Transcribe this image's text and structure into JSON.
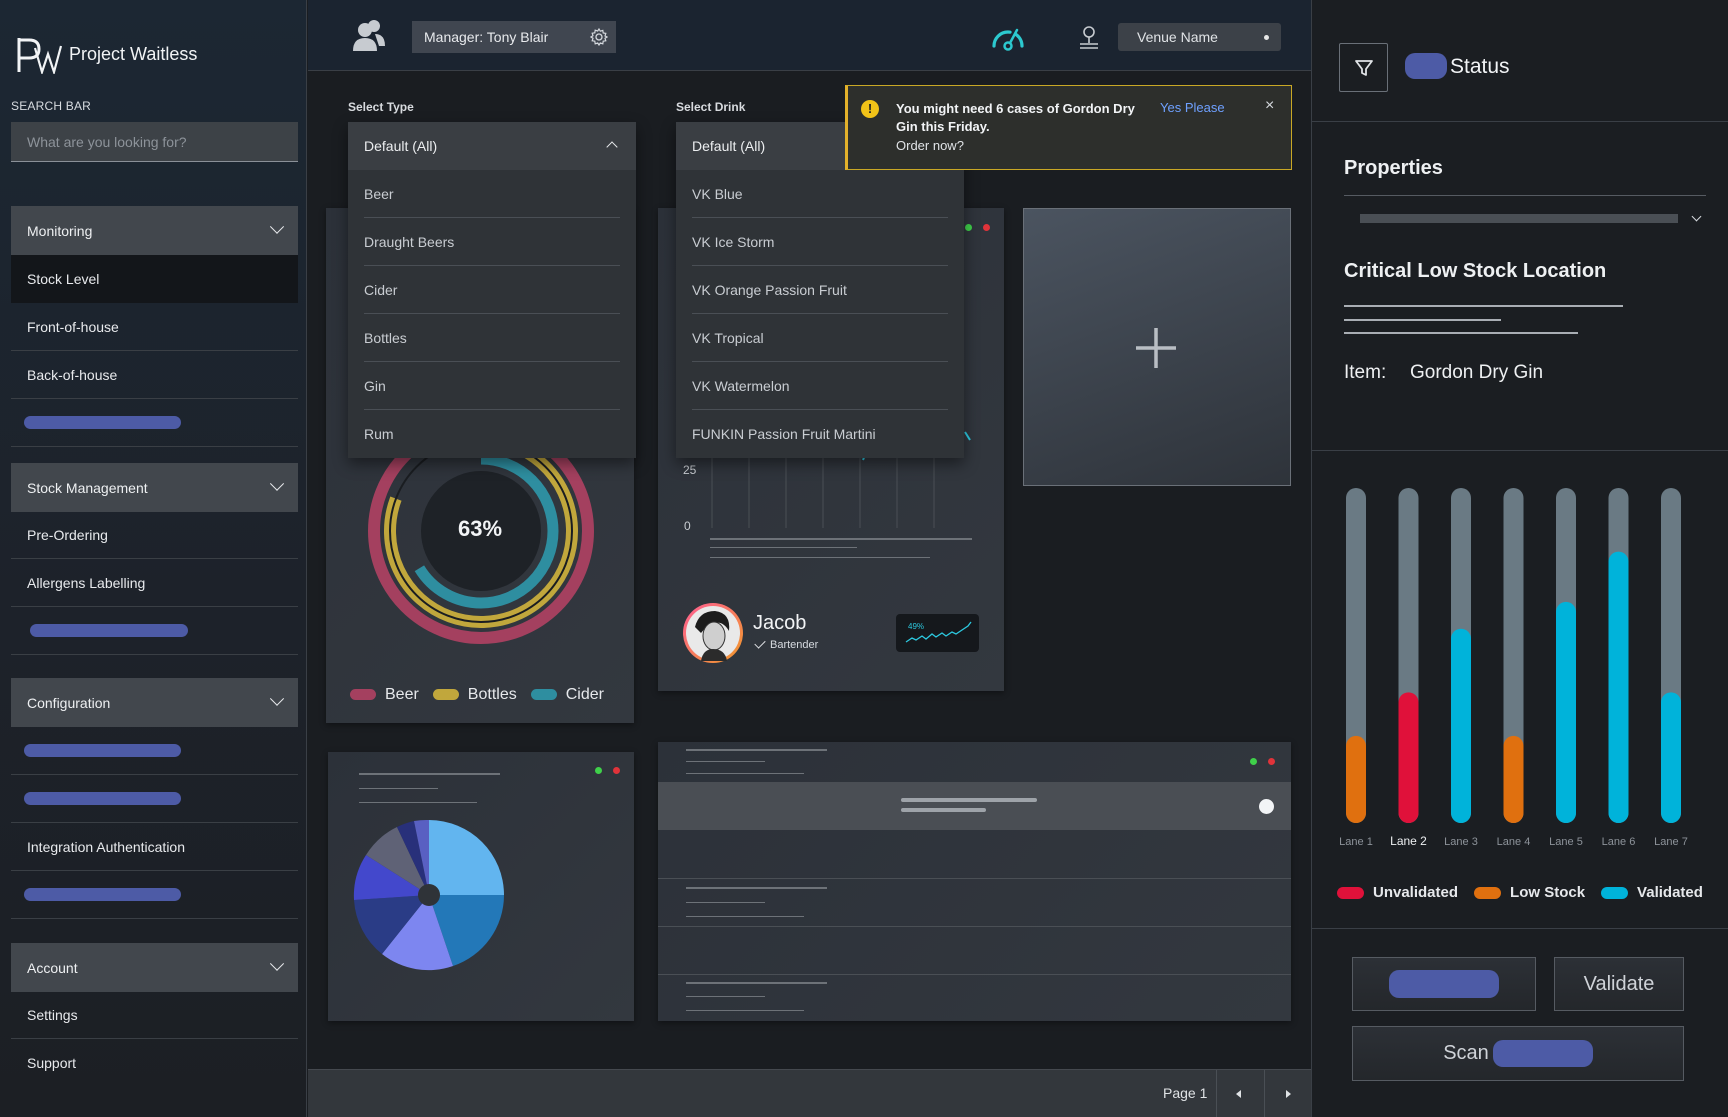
{
  "app": {
    "name": "Project Waitless"
  },
  "sidebar": {
    "search_label": "SEARCH BAR",
    "search_placeholder": "What are you looking for?",
    "groups": [
      {
        "label": "Monitoring",
        "items": [
          "Stock Level",
          "Front-of-house",
          "Back-of-house"
        ]
      },
      {
        "label": "Stock Management",
        "items": [
          "Pre-Ordering",
          "Allergens Labelling"
        ]
      },
      {
        "label": "Configuration",
        "items": [
          "Integration Authentication"
        ]
      },
      {
        "label": "Account",
        "items": [
          "Settings",
          "Support"
        ]
      }
    ]
  },
  "header": {
    "manager": "Manager: Tony Blair",
    "venue": "Venue Name"
  },
  "select_type": {
    "label": "Select Type",
    "value": "Default (All)",
    "options": [
      "Beer",
      "Draught Beers",
      "Cider",
      "Bottles",
      "Gin",
      "Rum"
    ]
  },
  "select_drink": {
    "label": "Select Drink",
    "value": "Default (All)",
    "options": [
      "VK Blue",
      "VK Ice Storm",
      "VK Orange Passion Fruit",
      "VK Tropical",
      "VK Watermelon",
      "FUNKIN Passion Fruit Martini"
    ]
  },
  "notification": {
    "message": "You might need 6 cases of Gordon Dry Gin this Friday.",
    "question": "Order now?",
    "action": "Yes Please"
  },
  "donut": {
    "center": "63%",
    "legend": [
      {
        "label": "Beer",
        "color": "#a4405f"
      },
      {
        "label": "Bottles",
        "color": "#c1a73c"
      },
      {
        "label": "Cider",
        "color": "#2e8ea0"
      }
    ]
  },
  "bar_card": {
    "tick_25": "25",
    "tick_0": "0"
  },
  "staff": {
    "name": "Jacob",
    "role": "Bartender",
    "sparkline_label": "49%"
  },
  "pagination": {
    "label": "Page 1"
  },
  "right_panel": {
    "status": "Status",
    "properties": "Properties",
    "critical_title": "Critical Low Stock Location",
    "item_label": "Item:",
    "item_value": "Gordon Dry Gin",
    "legend": [
      {
        "label": "Unvalidated",
        "color": "#e0113a"
      },
      {
        "label": "Low Stock",
        "color": "#e0700f"
      },
      {
        "label": "Validated",
        "color": "#00b3da"
      }
    ],
    "validate": "Validate",
    "scan": "Scan"
  },
  "chart_data": {
    "type": "bar",
    "categories": [
      "Lane 1",
      "Lane 2",
      "Lane 3",
      "Lane 4",
      "Lane 5",
      "Lane 6",
      "Lane 7"
    ],
    "values": [
      0.26,
      0.39,
      0.58,
      0.26,
      0.66,
      0.81,
      0.39
    ],
    "status": [
      "Low Stock",
      "Unvalidated",
      "Validated",
      "Low Stock",
      "Validated",
      "Validated",
      "Validated"
    ],
    "colors": {
      "Unvalidated": "#e0113a",
      "Low Stock": "#e0700f",
      "Validated": "#00b3da"
    },
    "ylim": [
      0,
      1
    ]
  }
}
